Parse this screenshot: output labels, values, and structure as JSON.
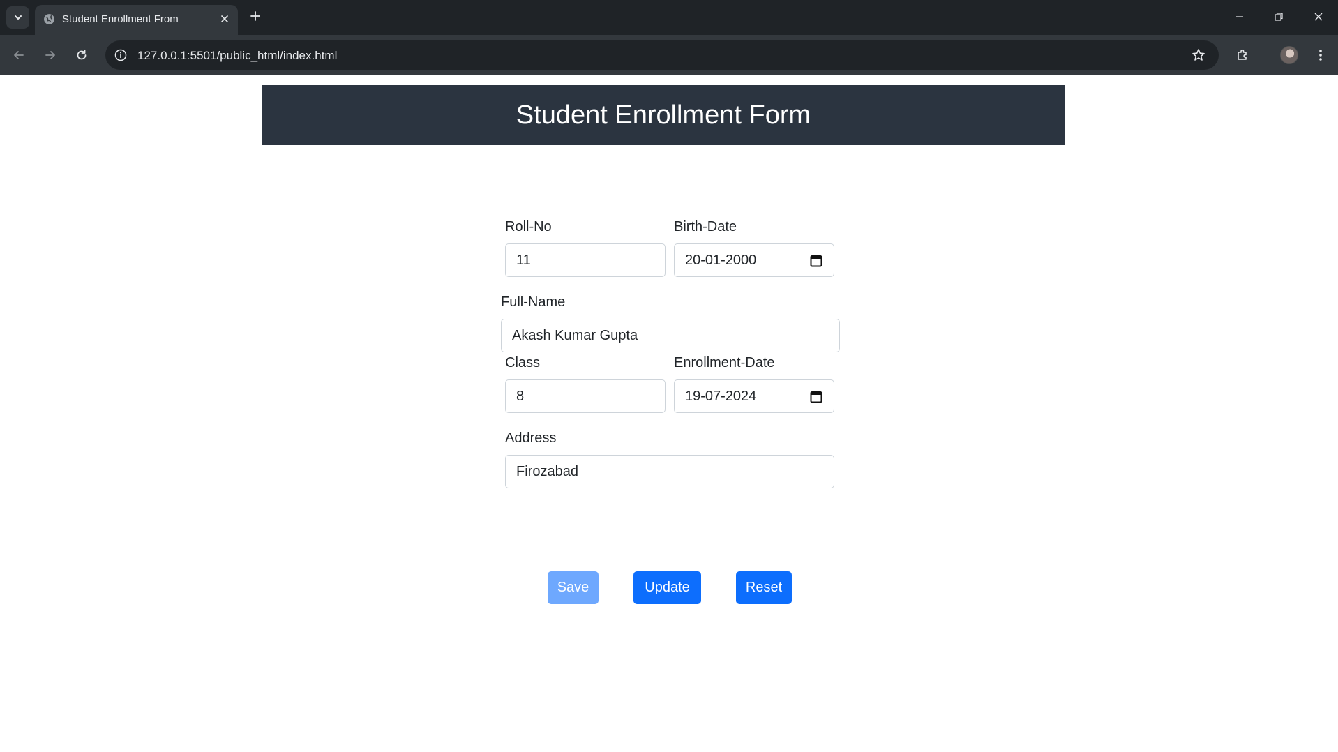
{
  "browser": {
    "tab_title": "Student Enrollment From",
    "url": "127.0.0.1:5501/public_html/index.html"
  },
  "page": {
    "header_title": "Student Enrollment Form"
  },
  "form": {
    "roll_no": {
      "label": "Roll-No",
      "value": "11"
    },
    "birth_date": {
      "label": "Birth-Date",
      "value": "20-01-2000"
    },
    "full_name": {
      "label": "Full-Name",
      "value": "Akash Kumar Gupta"
    },
    "class": {
      "label": "Class",
      "value": "8"
    },
    "enrollment_date": {
      "label": "Enrollment-Date",
      "value": "19-07-2024"
    },
    "address": {
      "label": "Address",
      "value": "Firozabad"
    }
  },
  "buttons": {
    "save": "Save",
    "update": "Update",
    "reset": "Reset"
  },
  "colors": {
    "header_bg": "#2b3440",
    "primary": "#0d6efd",
    "primary_disabled": "#6ea8fe"
  }
}
